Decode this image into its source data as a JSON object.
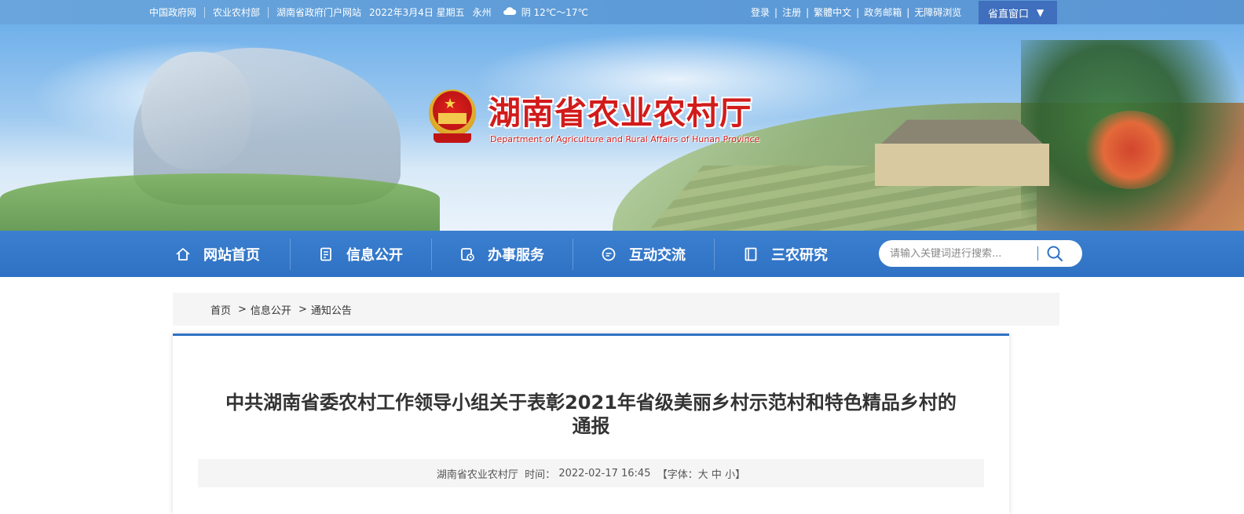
{
  "topbar": {
    "links": [
      "中国政府网",
      "农业农村部",
      "湖南省政府门户网站"
    ],
    "date": "2022年3月4日 星期五",
    "city": "永州",
    "weather": "阴 12℃～17℃",
    "right_links": [
      "登录",
      "注册",
      "繁體中文",
      "政务邮箱",
      "无障碍浏览"
    ],
    "province_button": "省直窗口",
    "province_arrow": "▼"
  },
  "header": {
    "title": "湖南省农业农村厅",
    "subtitle": "Department of Agriculture and Rural Affairs of Hunan Province"
  },
  "nav": {
    "items": [
      {
        "label": "网站首页",
        "icon": "home-icon"
      },
      {
        "label": "信息公开",
        "icon": "document-icon"
      },
      {
        "label": "办事服务",
        "icon": "service-icon"
      },
      {
        "label": "互动交流",
        "icon": "chat-icon"
      },
      {
        "label": "三农研究",
        "icon": "book-icon"
      }
    ],
    "search_placeholder": "请输入关键词进行搜索..."
  },
  "breadcrumb": [
    "首页",
    "信息公开",
    "通知公告"
  ],
  "article": {
    "title_line1": "中共湖南省委农村工作领导小组关于表彰2021年省级美丽乡村示范村和特色精品乡村的",
    "title_line2": "通报",
    "source": "湖南省农业农村厅",
    "time_label": "时间：",
    "time": "2022-02-17 16:45",
    "font_open": "【字体：",
    "font_large": "大",
    "font_medium": "中",
    "font_small": "小",
    "font_close": "】"
  },
  "colors": {
    "nav_blue": "#2f72c4",
    "title_red": "#d21b1b",
    "province_button": "#3f6fbd"
  }
}
